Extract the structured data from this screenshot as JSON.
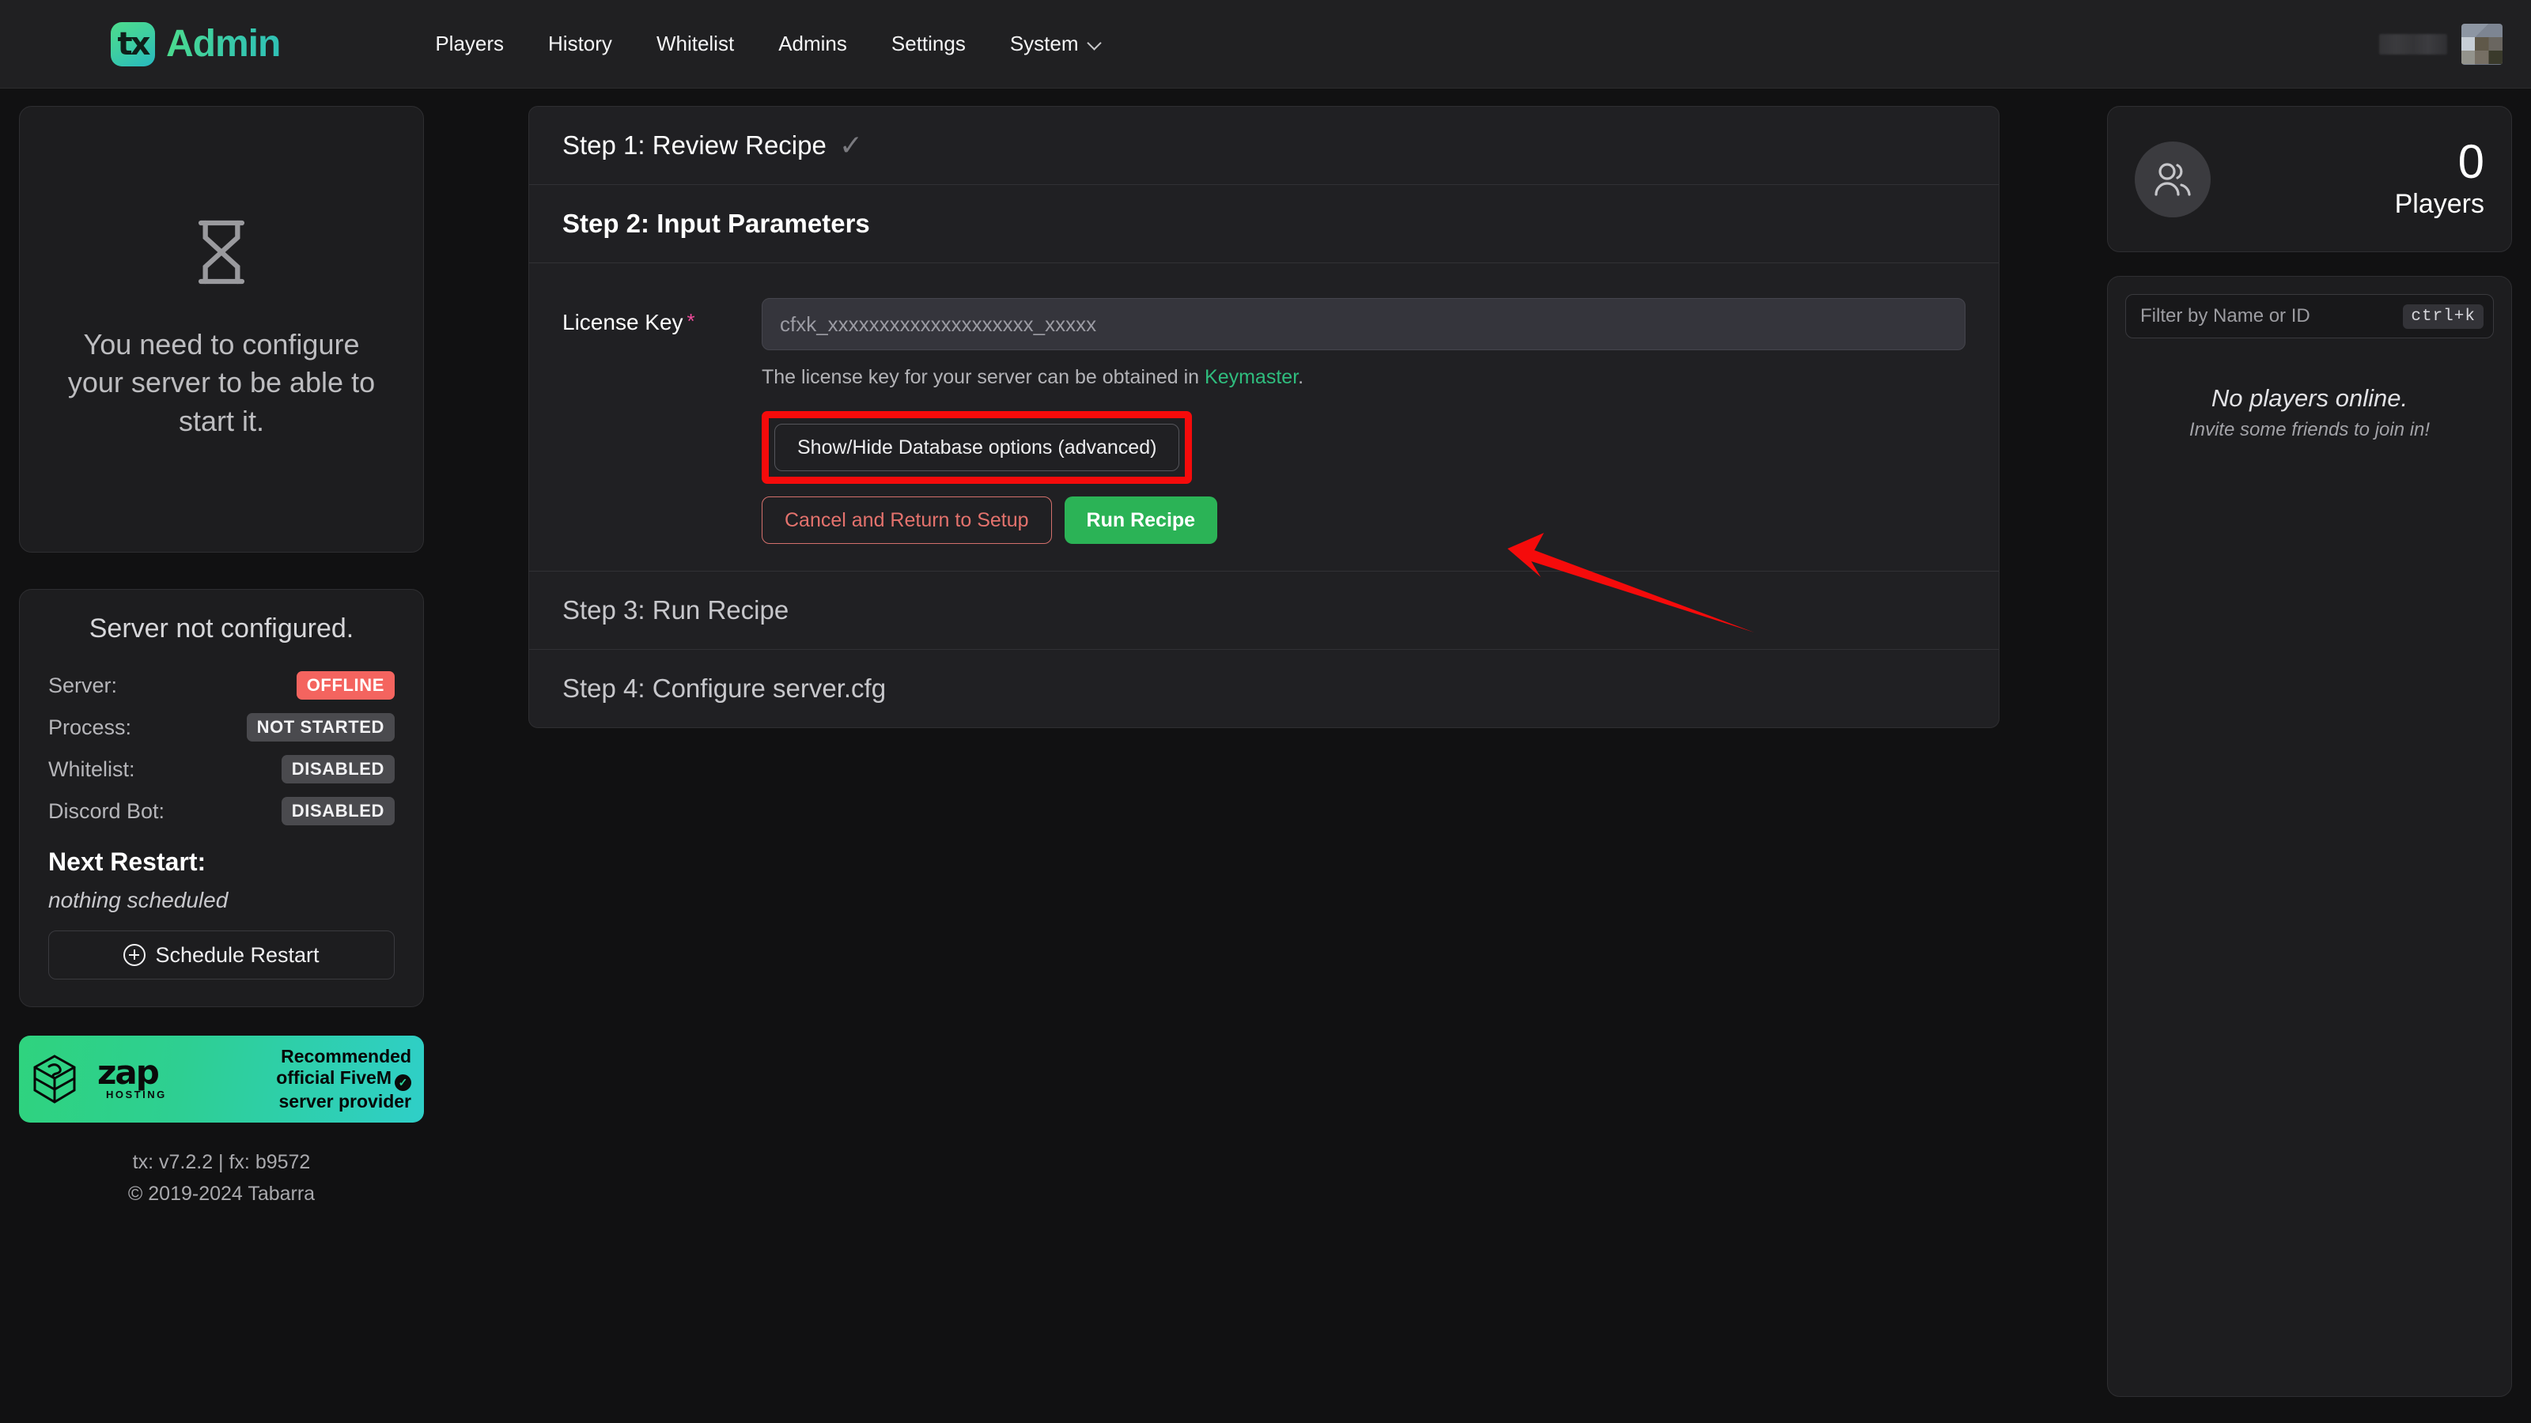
{
  "header": {
    "brand_mark": "tx",
    "brand_text": "Admin",
    "nav": [
      {
        "label": "Players",
        "has_chevron": false
      },
      {
        "label": "History",
        "has_chevron": false
      },
      {
        "label": "Whitelist",
        "has_chevron": false
      },
      {
        "label": "Admins",
        "has_chevron": false
      },
      {
        "label": "Settings",
        "has_chevron": false
      },
      {
        "label": "System",
        "has_chevron": true
      }
    ]
  },
  "left_sidebar": {
    "configure": {
      "icon": "hourglass-icon",
      "message": "You need to configure your server to be able to start it."
    },
    "status": {
      "title": "Server not configured.",
      "rows": [
        {
          "label": "Server:",
          "value": "OFFLINE",
          "style": "offline"
        },
        {
          "label": "Process:",
          "value": "NOT STARTED",
          "style": "muted"
        },
        {
          "label": "Whitelist:",
          "value": "DISABLED",
          "style": "muted"
        },
        {
          "label": "Discord Bot:",
          "value": "DISABLED",
          "style": "muted"
        }
      ],
      "next_restart_label": "Next Restart:",
      "next_restart_value": "nothing scheduled",
      "schedule_button": "Schedule Restart"
    },
    "zap_banner": {
      "logo_word": "zap",
      "logo_sub": "HOSTING",
      "line1": "Recommended",
      "line2": "official FiveM",
      "line3": "server provider",
      "verified_icon": "check-badge-icon"
    },
    "footer": {
      "versions": "tx: v7.2.2 | fx: b9572",
      "copyright": "© 2019-2024 Tabarra"
    }
  },
  "main": {
    "steps": [
      {
        "title": "Step 1: Review Recipe",
        "check": "✓",
        "state": "done"
      },
      {
        "title": "Step 2: Input Parameters",
        "state": "active"
      },
      {
        "title": "Step 3: Run Recipe",
        "state": "pending"
      },
      {
        "title": "Step 4: Configure server.cfg",
        "state": "pending"
      }
    ],
    "form": {
      "license_label": "License Key",
      "required_marker": "*",
      "license_placeholder": "cfxk_xxxxxxxxxxxxxxxxxxxx_xxxxx",
      "license_value": "",
      "help_prefix": "The license key for your server can be obtained in ",
      "help_link": "Keymaster",
      "help_suffix": ".",
      "advanced_button": "Show/Hide Database options (advanced)",
      "cancel_button": "Cancel and Return to Setup",
      "run_button": "Run Recipe"
    }
  },
  "right_sidebar": {
    "players_icon": "users-icon",
    "players_count": "0",
    "players_label": "Players",
    "filter_placeholder": "Filter by Name or ID",
    "filter_value": "",
    "filter_shortcut": "ctrl+k",
    "empty_title": "No players online.",
    "empty_subtitle": "Invite some friends to join in!"
  },
  "annotations": {
    "highlight_color": "#f50b0b",
    "arrow_target": "advanced-button"
  }
}
